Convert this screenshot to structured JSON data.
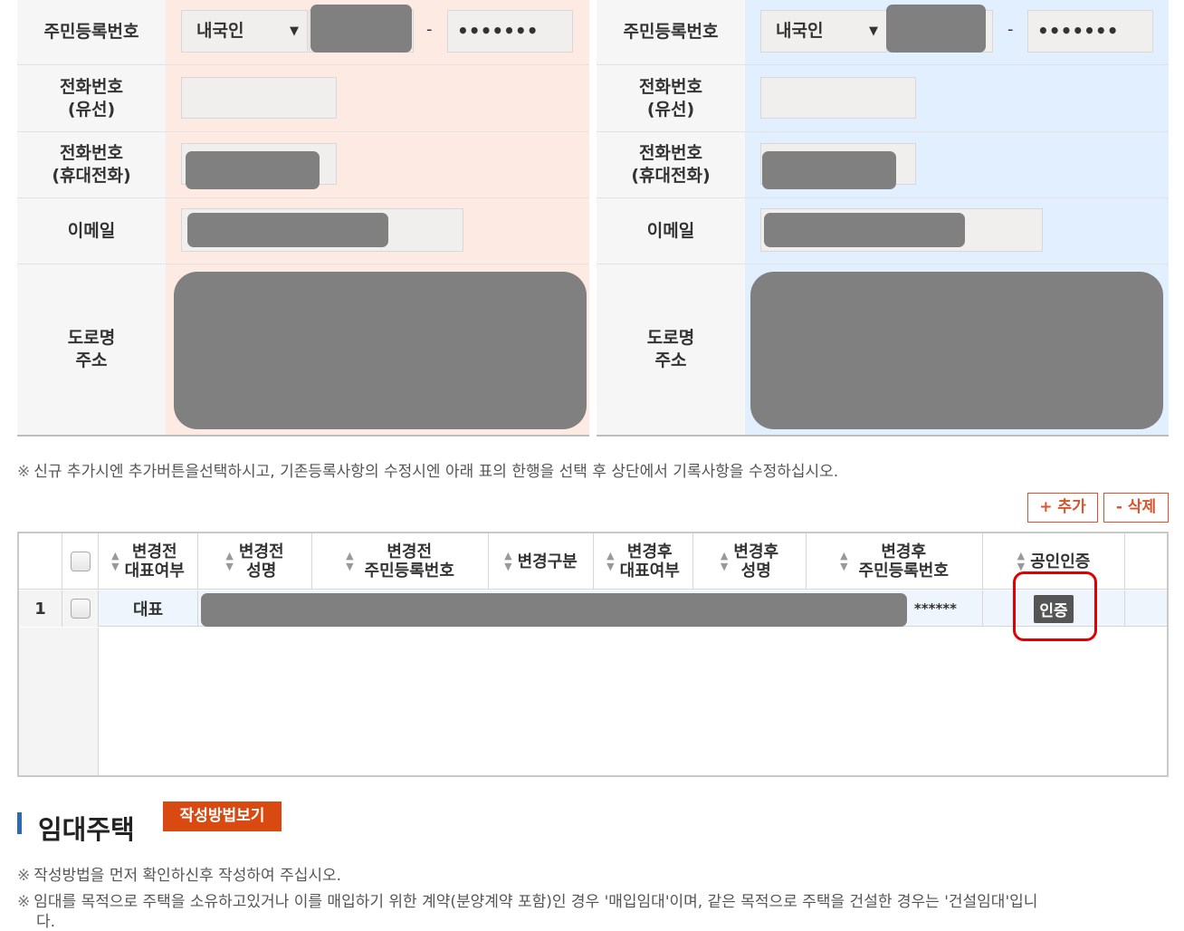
{
  "left_form": {
    "rrn_label": "주민등록번호",
    "nationality": "내국인",
    "rrn_back": "•••••••",
    "phone_label": "전화번호\n(유선)",
    "mobile_label": "전화번호\n(휴대전화)",
    "email_label": "이메일",
    "address_label": "도로명\n주소"
  },
  "right_form": {
    "rrn_label": "주민등록번호",
    "nationality": "내국인",
    "rrn_back": "•••••••",
    "phone_label": "전화번호\n(유선)",
    "mobile_label": "전화번호\n(휴대전화)",
    "email_label": "이메일",
    "address_label": "도로명\n주소"
  },
  "notice1": "신규 추가시엔 추가버튼을선택하시고, 기존등록사항의 수정시엔 아래 표의 한행을 선택 후 상단에서 기록사항을 수정하십시오.",
  "notice_mark": "※",
  "buttons": {
    "add": "+ 추가",
    "delete": "- 삭제"
  },
  "grid": {
    "headers": [
      "변경전\n대표여부",
      "변경전\n성명",
      "변경전\n주민등록번호",
      "변경구분",
      "변경후\n대표여부",
      "변경후\n성명",
      "변경후\n주민등록번호",
      "공인인증"
    ],
    "rows": [
      {
        "no": "1",
        "before_rep": "대표",
        "after_rrn_tail": "******",
        "cert": "인증"
      }
    ]
  },
  "section": {
    "title": "임대주택",
    "guide_button": "작성방법보기",
    "note1": "작성방법을 먼저 확인하신후 작성하여 주십시오.",
    "note2": "임대를 목적으로 주택을 소유하고있거나 이를 매입하기 위한 계약(분양계약 포함)인 경우 '매입임대'이며, 같은 목적으로 주택을 건설한 경우는 '건설임대'입니",
    "note2_cont": "다."
  }
}
